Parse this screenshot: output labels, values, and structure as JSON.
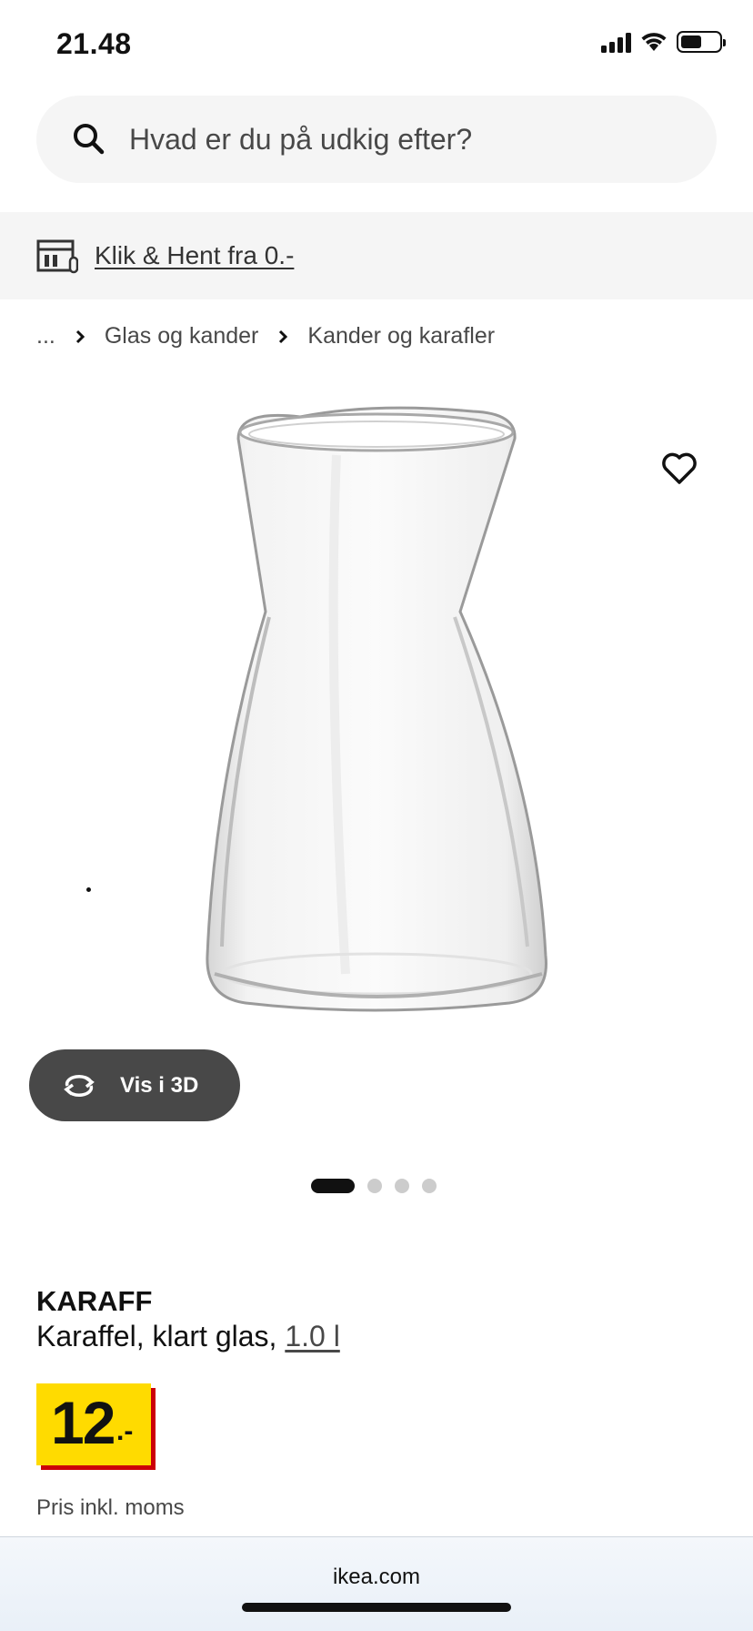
{
  "status_bar": {
    "time": "21.48",
    "battery_level": 0.55
  },
  "search": {
    "placeholder": "Hvad er du på udkig efter?",
    "icon": "search-icon"
  },
  "promo": {
    "label": "Klik & Hent fra 0.-",
    "icon": "store-icon"
  },
  "breadcrumb": {
    "ellipsis": "...",
    "items": [
      "Glas og kander",
      "Kander og karafler"
    ]
  },
  "product_image": {
    "view_3d_label": "Vis i 3D",
    "slides_total": 4,
    "slide_active": 1
  },
  "product": {
    "name": "KARAFF",
    "description": "Karaffel, klart glas, ",
    "size": "1.0 l",
    "price_integer": "12",
    "price_suffix": ".-",
    "price_note": "Pris inkl. moms"
  },
  "browser": {
    "url": "ikea.com"
  },
  "colors": {
    "price_box": "#ffdb00",
    "price_shadow": "#cc0008",
    "button_dark": "#484848"
  }
}
